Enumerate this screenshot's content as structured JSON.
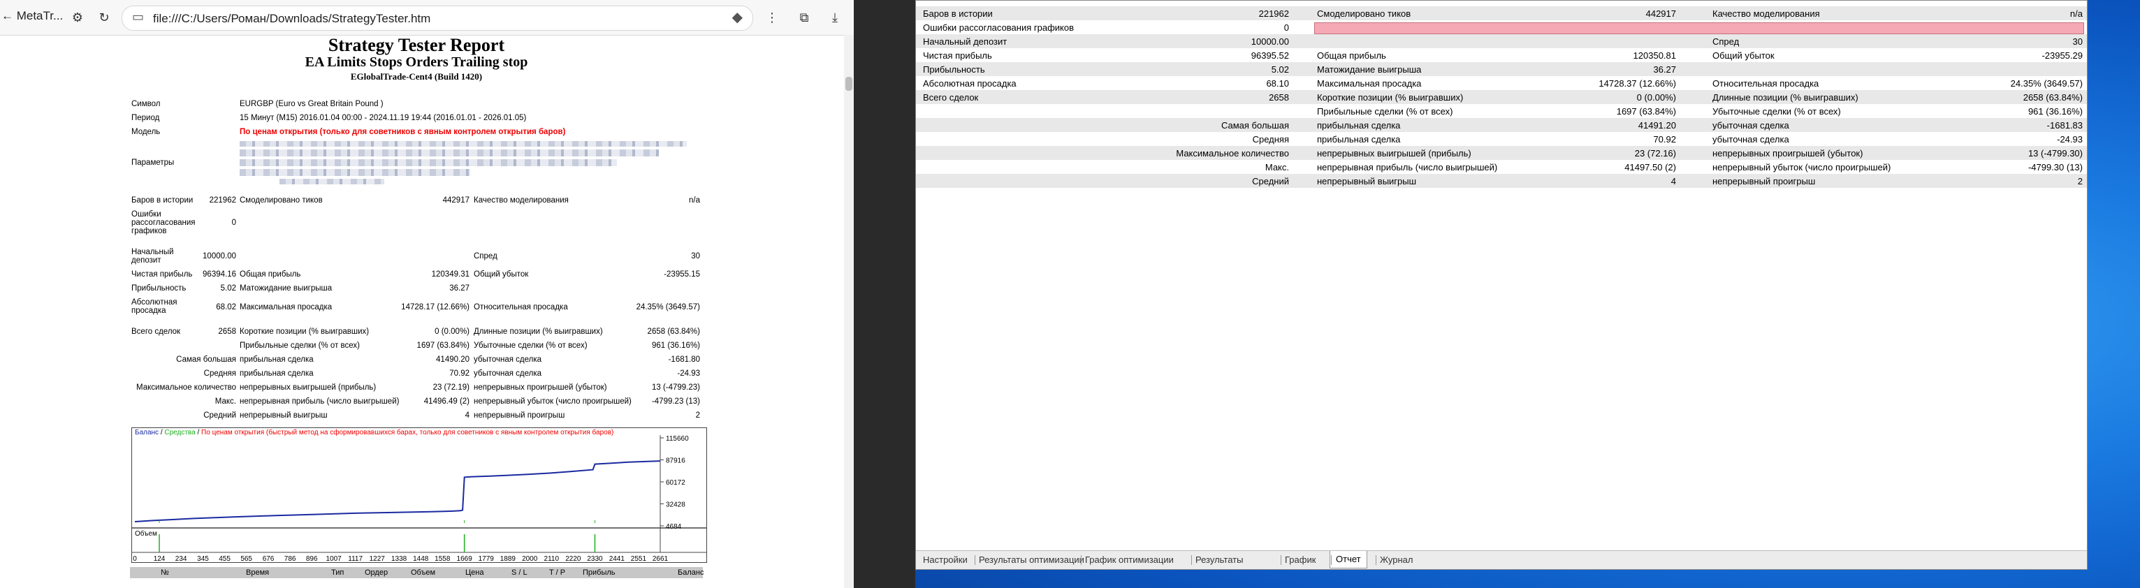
{
  "browser": {
    "back_label": "← MetaTr...",
    "address": "file:///C:/Users/Роман/Downloads/StrategyTester.htm"
  },
  "report": {
    "title": "Strategy Tester Report",
    "ea_name": "EA Limits Stops Orders Trailing stop",
    "server": "EGlobalTrade-Cent4 (Build 1420)",
    "symbol_label": "Символ",
    "symbol_value": "EURGBP (Euro vs Great Britain Pound )",
    "period_label": "Период",
    "period_value": "15 Минут (M15) 2016.01.04 00:00 - 2024.11.19 19:44 (2016.01.01 - 2026.01.05)",
    "model_label": "Модель",
    "model_value": "По ценам открытия (только для советников с явным контролем открытия баров)",
    "params_label": "Параметры",
    "bars_label": "Баров в истории",
    "bars_value": "221962",
    "ticks_label": "Смоделировано тиков",
    "ticks_value": "442917",
    "quality_label": "Качество моделирования",
    "quality_value": "n/a",
    "errors_label_1": "Ошибки",
    "errors_label_2": "рассогласования",
    "errors_label_3": "графиков",
    "errors_value": "0",
    "deposit_label_1": "Начальный",
    "deposit_label_2": "депозит",
    "deposit_value": "10000.00",
    "spread_label": "Спред",
    "spread_value": "30",
    "net_label": "Чистая прибыль",
    "net_value": "96394.16",
    "gross_profit_label": "Общая прибыль",
    "gross_profit_value": "120349.31",
    "gross_loss_label": "Общий убыток",
    "gross_loss_value": "-23955.15",
    "pf_label": "Прибыльность",
    "pf_value": "5.02",
    "payoff_label": "Матожидание выигрыша",
    "payoff_value": "36.27",
    "abs_dd_label_1": "Абсолютная",
    "abs_dd_label_2": "просадка",
    "abs_dd_value": "68.02",
    "max_dd_label": "Максимальная просадка",
    "max_dd_value": "14728.17 (12.66%)",
    "rel_dd_label": "Относительная просадка",
    "rel_dd_value": "24.35% (3649.57)",
    "total_label": "Всего сделок",
    "total_value": "2658",
    "short_label": "Короткие позиции (% выигравших)",
    "short_value": "0 (0.00%)",
    "long_label": "Длинные позиции (% выигравших)",
    "long_value": "2658 (63.84%)",
    "profit_trades_label": "Прибыльные сделки (% от всех)",
    "profit_trades_value": "1697 (63.84%)",
    "loss_trades_label": "Убыточные сделки (% от всех)",
    "loss_trades_value": "961 (36.16%)",
    "largest_label": "Самая большая",
    "largest_profit_label": "прибыльная сделка",
    "largest_profit_value": "41490.20",
    "largest_loss_label": "убыточная сделка",
    "largest_loss_value": "-1681.80",
    "avg_label": "Средняя",
    "avg_profit_label": "прибыльная сделка",
    "avg_profit_value": "70.92",
    "avg_loss_label": "убыточная сделка",
    "avg_loss_value": "-24.93",
    "maxcount_label": "Максимальное количество",
    "cons_wins_label": "непрерывных выигрышей (прибыль)",
    "cons_wins_value": "23 (72.19)",
    "cons_losses_label": "непрерывных проигрышей (убыток)",
    "cons_losses_value": "13 (-4799.23)",
    "max_label": "Макс.",
    "cons_profit_label": "непрерывная прибыль (число выигрышей)",
    "cons_profit_value": "41496.49 (2)",
    "cons_loss_label": "непрерывный убыток (число проигрышей)",
    "cons_loss_value": "-4799.23 (13)",
    "mean_label": "Средний",
    "mean_win_label": "непрерывный выигрыш",
    "mean_win_value": "4",
    "mean_loss_label": "непрерывный проигрыш",
    "mean_loss_value": "2"
  },
  "chart": {
    "legend_balance": "Баланс",
    "legend_equity": "Средства",
    "legend_sep": " / ",
    "legend_note": "По ценам открытия (быстрый метод на сформировавшихся барах, только для советников с явным контролем открытия баров)",
    "volume_label": "Объем",
    "colors": {
      "balance": "#1a2aa0",
      "equity": "#20b020",
      "note": "#ee0000"
    }
  },
  "chart_data": {
    "type": "line",
    "x_ticks": [
      "0",
      "124",
      "234",
      "345",
      "455",
      "565",
      "676",
      "786",
      "896",
      "1007",
      "1117",
      "1227",
      "1338",
      "1448",
      "1558",
      "1669",
      "1779",
      "1889",
      "2000",
      "2110",
      "2220",
      "2330",
      "2441",
      "2551",
      "2661"
    ],
    "y_ticks": [
      "115660",
      "87916",
      "60172",
      "32428",
      "4684"
    ],
    "ylim": [
      4684,
      115660
    ],
    "xlim": [
      0,
      2661
    ],
    "series": [
      {
        "name": "Баланс",
        "x": [
          0,
          100,
          300,
          500,
          700,
          900,
          1100,
          1300,
          1500,
          1600,
          1650,
          1660,
          1669,
          1700,
          1800,
          1900,
          2000,
          2100,
          2200,
          2320,
          2330,
          2400,
          2500,
          2661
        ],
        "values": [
          10000,
          11500,
          14000,
          16000,
          17500,
          19000,
          20500,
          21500,
          22500,
          23200,
          23800,
          24500,
          66000,
          66500,
          67500,
          68500,
          69800,
          71200,
          73000,
          75500,
          82500,
          83500,
          85000,
          86500
        ]
      }
    ],
    "volume_spikes_x": [
      124,
      1669,
      2330
    ]
  },
  "trade_table": {
    "headers": [
      "№",
      "Время",
      "Тип",
      "Ордер",
      "Объем",
      "Цена",
      "S / L",
      "T / P",
      "Прибыль",
      "Баланс"
    ]
  },
  "mt4": {
    "rows": [
      [
        "Баров в истории",
        "221962",
        "Смоделировано тиков",
        "442917",
        "Качество моделирования",
        "n/a"
      ],
      [
        "Ошибки рассогласования графиков",
        "0",
        "",
        "",
        "",
        ""
      ],
      [
        "Начальный депозит",
        "10000.00",
        "",
        "",
        "Спред",
        "30"
      ],
      [
        "Чистая прибыль",
        "96395.52",
        "Общая прибыль",
        "120350.81",
        "Общий убыток",
        "-23955.29"
      ],
      [
        "Прибыльность",
        "5.02",
        "Матожидание выигрыша",
        "36.27",
        "",
        ""
      ],
      [
        "Абсолютная просадка",
        "68.10",
        "Максимальная просадка",
        "14728.37 (12.66%)",
        "Относительная просадка",
        "24.35% (3649.57)"
      ],
      [
        "Всего сделок",
        "2658",
        "Короткие позиции (% выигравших)",
        "0 (0.00%)",
        "Длинные позиции (% выигравших)",
        "2658 (63.84%)"
      ],
      [
        "",
        "",
        "Прибыльные сделки (% от всех)",
        "1697 (63.84%)",
        "Убыточные сделки (% от всех)",
        "961 (36.16%)"
      ],
      [
        "Самая большая",
        "",
        "прибыльная сделка",
        "41491.20",
        "убыточная сделка",
        "-1681.83"
      ],
      [
        "Средняя",
        "",
        "прибыльная сделка",
        "70.92",
        "убыточная сделка",
        "-24.93"
      ],
      [
        "Максимальное количество",
        "",
        "непрерывных выигрышей (прибыль)",
        "23 (72.16)",
        "непрерывных проигрышей (убыток)",
        "13 (-4799.30)"
      ],
      [
        "Макс.",
        "",
        "непрерывная прибыль (число выигрышей)",
        "41497.50 (2)",
        "непрерывный убыток (число проигрышей)",
        "-4799.30 (13)"
      ],
      [
        "Средний",
        "",
        "непрерывный выигрыш",
        "4",
        "непрерывный проигрыш",
        "2"
      ]
    ],
    "tabs": [
      "Настройки",
      "Результаты оптимизации",
      "График оптимизации",
      "Результаты",
      "График",
      "Отчет",
      "Журнал"
    ],
    "active_tab": "Отчет"
  }
}
